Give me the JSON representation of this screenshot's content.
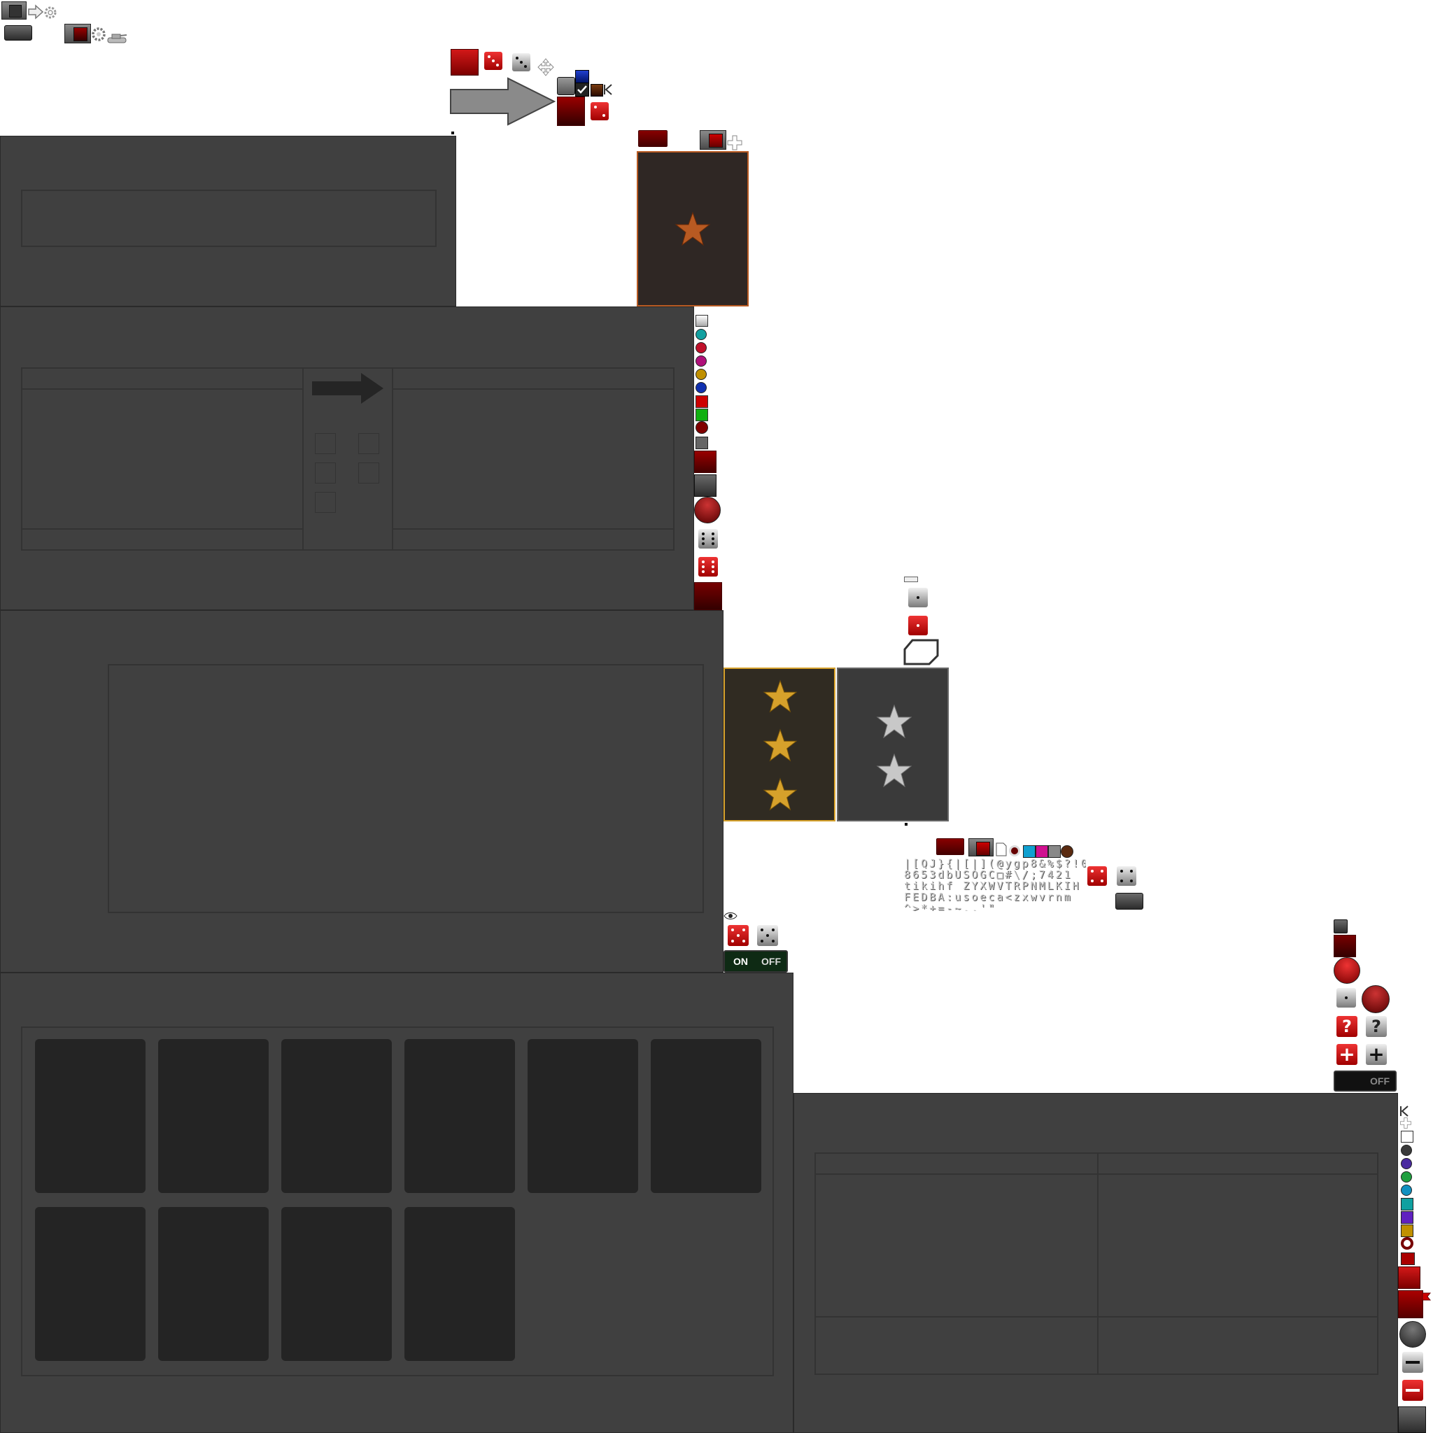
{
  "toggle_on_off": {
    "on_label": "ON",
    "off_label": "OFF"
  },
  "toggle_off": {
    "off_label": "OFF"
  },
  "font_sheet": {
    "line1": "|[QJ}{|[|](@ygp8&%$?!09",
    "line2": "8653dbUSOGC□#\\/;7421",
    "line3": "tikihf ZYXWVTRPNMLKIH",
    "line4": "FEDBA:usoeca<zxwvrnm",
    "line5": "^>*+=-~.,'\"_"
  },
  "icons": {
    "question_red": "?",
    "question_grey": "?",
    "plus_red": "+",
    "plus_grey": "+"
  },
  "colors": {
    "panel_bg": "#404040",
    "tile_bg": "#242424",
    "accent_red": "#b00000",
    "gold_star": "#d6a12b",
    "silver_star": "#c8c8c8",
    "bronze_star": "#b85a22"
  },
  "orb_colors_left": [
    "#dddddd",
    "#12a0a0",
    "#c0102a",
    "#b0107a",
    "#c09000",
    "#1030b0",
    "#cc0000",
    "#10b010",
    "#800000",
    "#808080"
  ],
  "orb_colors_right": [
    "#3a3a3a",
    "#4a2aa0",
    "#20a040",
    "#1090c0",
    "#10a0a0",
    "#6020c0",
    "#c09000",
    "#ffffff"
  ]
}
